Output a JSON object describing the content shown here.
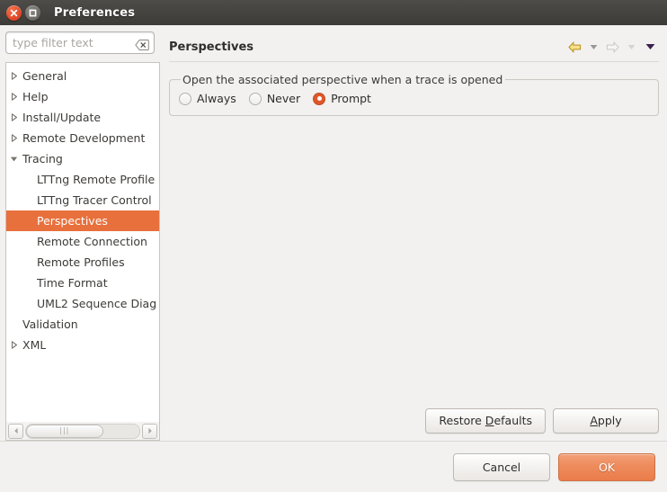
{
  "window": {
    "title": "Preferences",
    "close_icon": "close-icon",
    "maximize_icon": "maximize-icon"
  },
  "sidebar": {
    "filter": {
      "value": "",
      "placeholder": "type filter text",
      "clear_icon": "clear-filter-icon"
    },
    "items": [
      {
        "label": "General",
        "level": 1,
        "twisty": "collapsed",
        "selected": false
      },
      {
        "label": "Help",
        "level": 1,
        "twisty": "collapsed",
        "selected": false
      },
      {
        "label": "Install/Update",
        "level": 1,
        "twisty": "collapsed",
        "selected": false
      },
      {
        "label": "Remote Development",
        "level": 1,
        "twisty": "collapsed",
        "selected": false
      },
      {
        "label": "Tracing",
        "level": 1,
        "twisty": "expanded",
        "selected": false
      },
      {
        "label": "LTTng Remote Profile",
        "level": 2,
        "twisty": "none",
        "selected": false
      },
      {
        "label": "LTTng Tracer Control",
        "level": 2,
        "twisty": "none",
        "selected": false
      },
      {
        "label": "Perspectives",
        "level": 2,
        "twisty": "none",
        "selected": true
      },
      {
        "label": "Remote Connection",
        "level": 2,
        "twisty": "none",
        "selected": false
      },
      {
        "label": "Remote Profiles",
        "level": 2,
        "twisty": "none",
        "selected": false
      },
      {
        "label": "Time Format",
        "level": 2,
        "twisty": "none",
        "selected": false
      },
      {
        "label": "UML2 Sequence Diag",
        "level": 2,
        "twisty": "none",
        "selected": false
      },
      {
        "label": "Validation",
        "level": 1,
        "twisty": "none",
        "selected": false
      },
      {
        "label": "XML",
        "level": 1,
        "twisty": "collapsed",
        "selected": false
      }
    ],
    "scrollbar": {
      "left_arrow_icon": "scroll-left-icon",
      "right_arrow_icon": "scroll-right-icon",
      "grip": "|||"
    }
  },
  "page": {
    "title": "Perspectives",
    "nav": {
      "back_icon": "back-arrow-icon",
      "back_menu_icon": "back-history-dropdown-icon",
      "forward_icon": "forward-arrow-icon",
      "forward_menu_icon": "forward-history-dropdown-icon",
      "view_menu_icon": "view-menu-dropdown-icon"
    },
    "group": {
      "legend": "Open the associated perspective when a trace is opened",
      "options": [
        {
          "label": "Always",
          "selected": false
        },
        {
          "label": "Never",
          "selected": false
        },
        {
          "label": "Prompt",
          "selected": true
        }
      ]
    },
    "restore_defaults_label": "Restore Defaults",
    "restore_defaults_mnemonic": "D",
    "apply_label": "Apply",
    "apply_mnemonic": "A"
  },
  "footer": {
    "cancel_label": "Cancel",
    "ok_label": "OK"
  },
  "colors": {
    "accent_selection": "#e8703c",
    "accent_primary_button": "#ea7c4a",
    "radio_selected": "#e0562a",
    "titlebar": "#3c3b37",
    "dialog_background": "#f2f1f0"
  }
}
